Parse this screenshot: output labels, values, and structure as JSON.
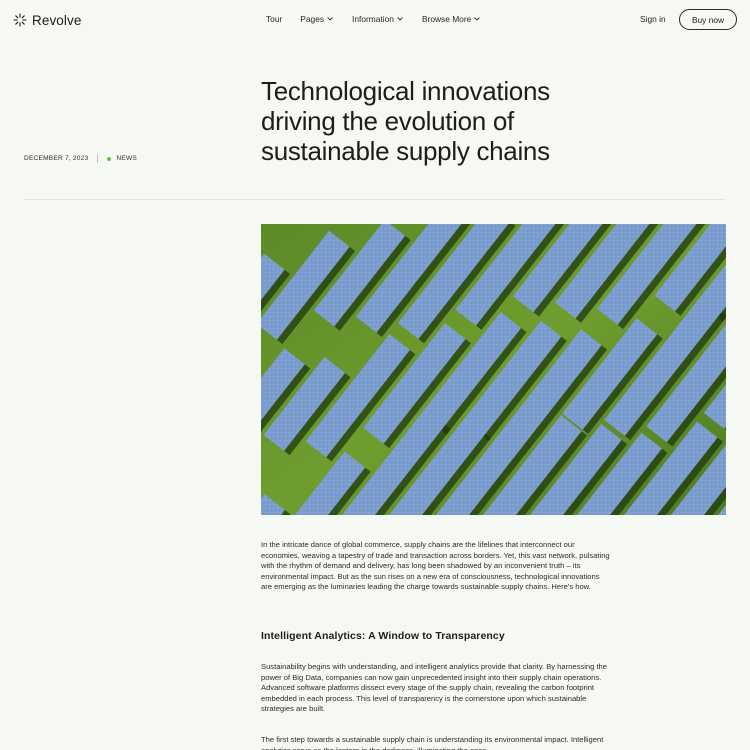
{
  "header": {
    "brand": "Revolve",
    "nav": [
      {
        "label": "Tour",
        "has_dropdown": false
      },
      {
        "label": "Pages",
        "has_dropdown": true
      },
      {
        "label": "Information",
        "has_dropdown": true
      },
      {
        "label": "Browse More",
        "has_dropdown": true
      }
    ],
    "sign_in": "Sign in",
    "buy_now": "Buy now"
  },
  "article": {
    "date": "DECEMBER 7, 2023",
    "category": "NEWS",
    "category_dot_color": "#6cc04a",
    "title": "Technological innovations driving the evolution of sustainable supply chains",
    "hero_image": "aerial-solar-panels-on-grass",
    "intro": "In the intricate dance of global commerce, supply chains are the lifelines that interconnect our economies, weaving a tapestry of trade and transaction across borders. Yet, this vast network, pulsating with the rhythm of demand and delivery, has long been shadowed by an inconvenient truth – its environmental impact. But as the sun rises on a new era of consciousness, technological innovations are emerging as the luminaries leading the charge towards sustainable supply chains. Here's how.",
    "section_heading": "Intelligent Analytics: A Window to Transparency",
    "section_p1": "Sustainability begins with understanding, and intelligent analytics provide that clarity. By harnessing the power of Big Data, companies can now gain unprecedented insight into their supply chain operations. Advanced software platforms dissect every stage of the supply chain, revealing the carbon footprint embedded in each process. This level of transparency is the cornerstone upon which sustainable strategies are built.",
    "section_p2": "The first step towards a sustainable supply chain is understanding its environmental impact. Intelligent analytics serve as the lantern in the darkness, illuminating the once"
  },
  "colors": {
    "background": "#f6f8f3",
    "text": "#1d1f1b",
    "accent_dot": "#6cc04a"
  }
}
